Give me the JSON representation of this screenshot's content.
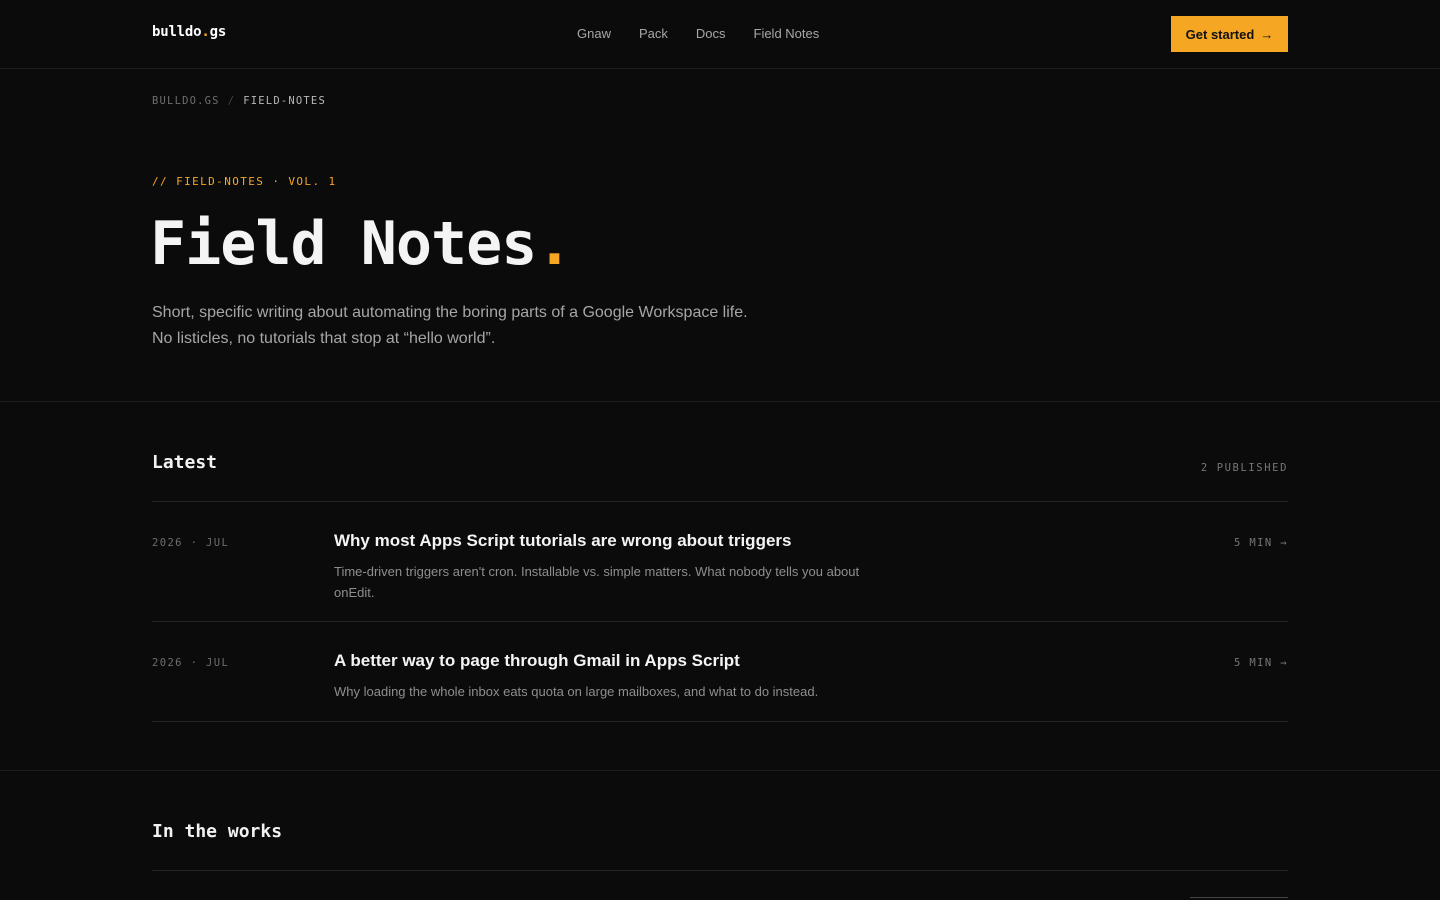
{
  "header": {
    "logo_main": "bulldo",
    "logo_dot": ".",
    "logo_tld": "gs",
    "nav": [
      "Gnaw",
      "Pack",
      "Docs",
      "Field Notes"
    ],
    "cta_label": "Get started",
    "cta_icon": "arrow-right-icon",
    "cta_glyph": "→"
  },
  "breadcrumb": {
    "home": "BULLDO.GS",
    "separator": "/",
    "current": "FIELD-NOTES"
  },
  "hero": {
    "eyebrow": "// FIELD-NOTES · VOL. 1",
    "title": "Field Notes",
    "title_accent": ".",
    "description": "Short, specific writing about automating the boring parts of a Google Workspace life. No listicles, no tutorials that stop at “hello world”."
  },
  "latest": {
    "title": "Latest",
    "count_label": "2 PUBLISHED",
    "posts": [
      {
        "date": "2026 · JUL",
        "title": "Why most Apps Script tutorials are wrong about triggers",
        "excerpt": "Time-driven triggers aren't cron. Installable vs. simple matters. What nobody tells you about onEdit.",
        "read_time": "5 MIN →"
      },
      {
        "date": "2026 · JUL",
        "title": "A better way to page through Gmail in Apps Script",
        "excerpt": "Why loading the whole inbox eats quota on large mailboxes, and what to do instead.",
        "read_time": "5 MIN →"
      }
    ]
  },
  "in_the_works": {
    "title": "In the works"
  },
  "colors": {
    "background": "#0b0b0b",
    "accent": "#f5a623",
    "text": "#f2f2f2",
    "muted": "#a6a6a6"
  }
}
